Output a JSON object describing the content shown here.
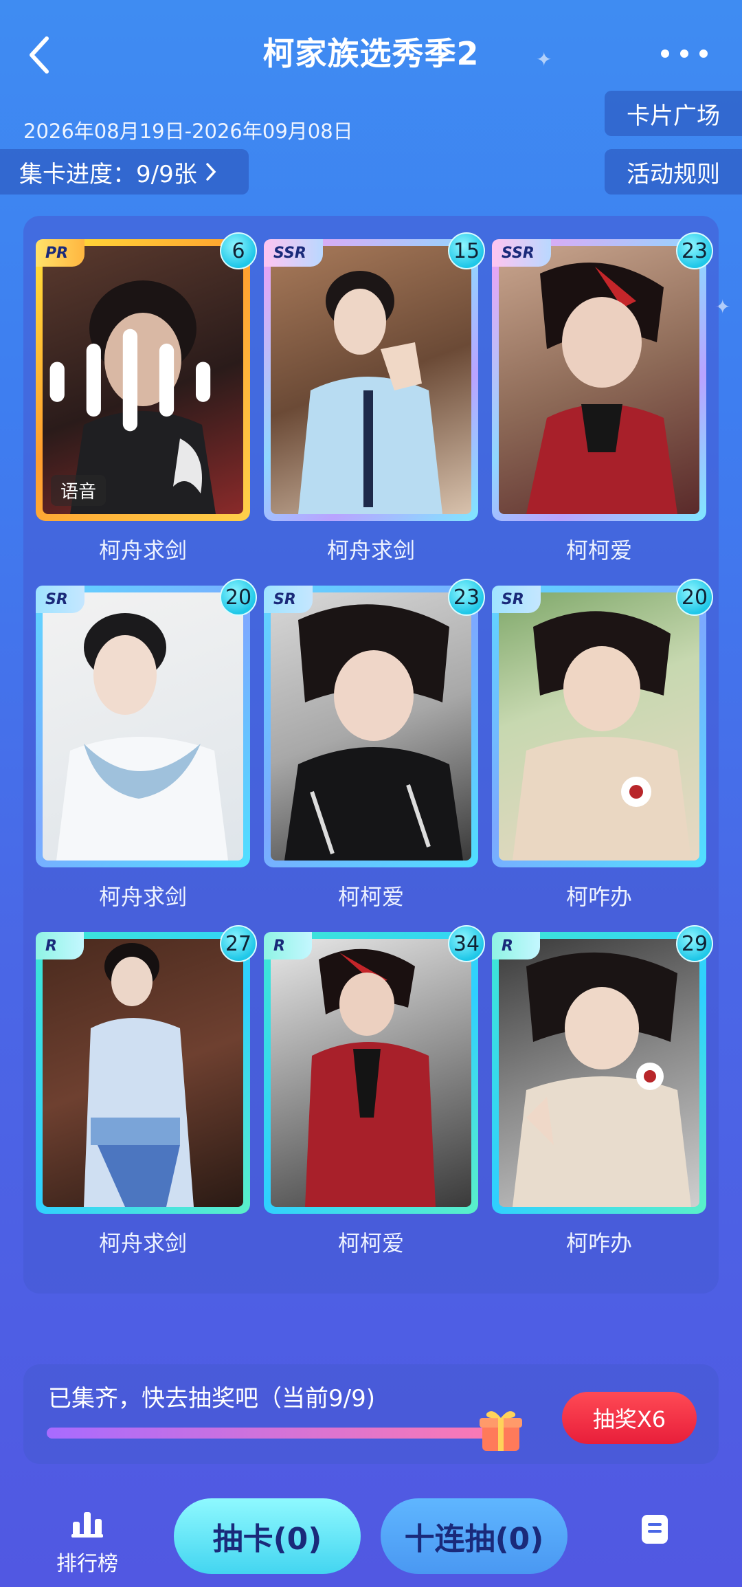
{
  "header": {
    "title": "柯家族选秀季2",
    "date_range": "2026年08月19日-2026年09月08日",
    "card_plaza": "卡片广场",
    "rules": "活动规则",
    "progress_label": "集卡进度：9/9张"
  },
  "cards": [
    {
      "rarity": "PR",
      "count": "6",
      "name": "柯舟求剑",
      "voice_label": "语音"
    },
    {
      "rarity": "SSR",
      "count": "15",
      "name": "柯舟求剑"
    },
    {
      "rarity": "SSR",
      "count": "23",
      "name": "柯柯爱"
    },
    {
      "rarity": "SR",
      "count": "20",
      "name": "柯舟求剑"
    },
    {
      "rarity": "SR",
      "count": "23",
      "name": "柯柯爱"
    },
    {
      "rarity": "SR",
      "count": "20",
      "name": "柯咋办"
    },
    {
      "rarity": "R",
      "count": "27",
      "name": "柯舟求剑"
    },
    {
      "rarity": "R",
      "count": "34",
      "name": "柯柯爱"
    },
    {
      "rarity": "R",
      "count": "29",
      "name": "柯咋办"
    }
  ],
  "lottery": {
    "text": "已集齐，快去抽奖吧（当前9/9)",
    "progress": 1.0,
    "button": "抽奖X6"
  },
  "bottom": {
    "rank_label": "排行榜",
    "draw_label": "抽卡(0)",
    "draw10_label": "十连抽(0)"
  }
}
